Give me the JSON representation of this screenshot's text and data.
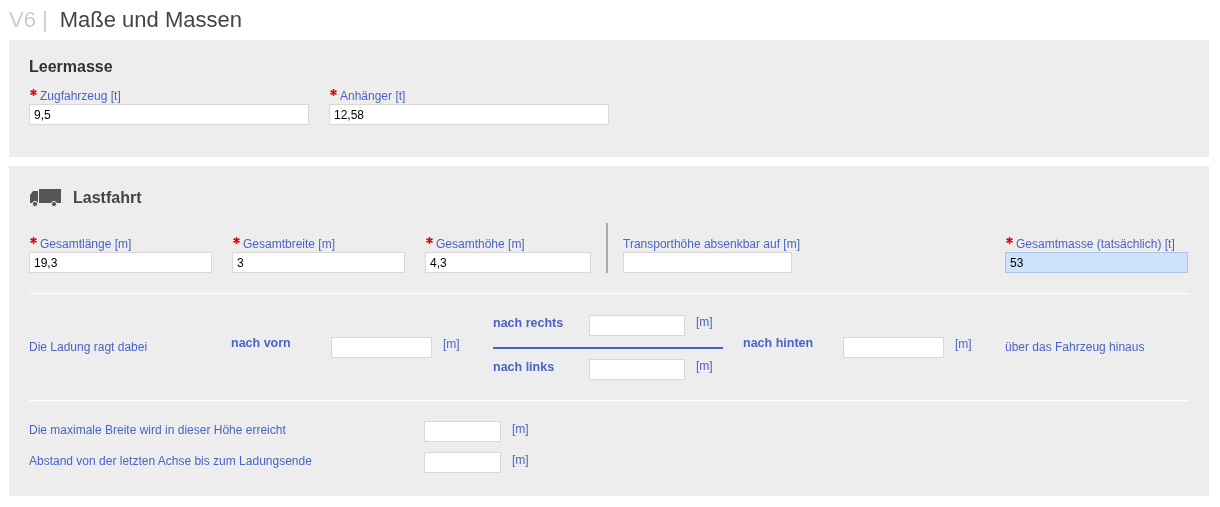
{
  "header": {
    "prefix": "V6 |",
    "title": "Maße und Massen"
  },
  "leermasse": {
    "title": "Leermasse",
    "fields": [
      {
        "label": "Zugfahrzeug [t]",
        "required": true,
        "value": "9,5",
        "highlighted": false
      },
      {
        "label": "Anhänger [t]",
        "required": true,
        "value": "12,58",
        "highlighted": false
      }
    ]
  },
  "lastfahrt": {
    "title": "Lastfahrt",
    "fields": [
      {
        "label": "Gesamtlänge [m]",
        "required": true,
        "value": "19,3",
        "highlighted": false
      },
      {
        "label": "Gesamtbreite [m]",
        "required": true,
        "value": "3",
        "highlighted": false
      },
      {
        "label": "Gesamthöhe [m]",
        "required": true,
        "value": "4,3",
        "highlighted": false
      },
      {
        "label": "Transporthöhe absenkbar auf [m]",
        "required": false,
        "highlighted": false
      },
      {
        "label": "Gesamtmasse (tatsächlich) [t]",
        "required": true,
        "value": "53",
        "highlighted": true
      }
    ],
    "overhang": {
      "intro": "Die Ladung ragt dabei",
      "front": {
        "label": "nach vorn",
        "unit": "[m]"
      },
      "right": {
        "label": "nach rechts",
        "unit": "[m]"
      },
      "left": {
        "label": "nach links",
        "unit": "[m]"
      },
      "rear": {
        "label": "nach hinten",
        "unit": "[m]"
      },
      "outro": "über das Fahrzeug hinaus"
    },
    "extra": [
      {
        "label": "Die maximale Breite wird in dieser Höhe erreicht",
        "unit": "[m]"
      },
      {
        "label": "Abstand von der letzten Achse bis zum Ladungsende",
        "unit": "[m]"
      }
    ]
  }
}
